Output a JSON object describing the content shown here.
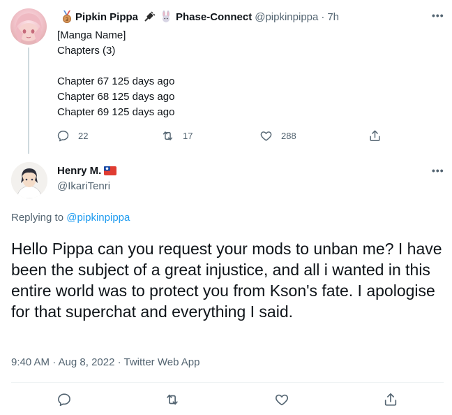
{
  "parent": {
    "display_name": "Pipkin Pippa",
    "org_name": "Phase-Connect",
    "handle": "@pipkinpippa",
    "separator": "·",
    "time": "7h",
    "text": "[Manga Name]\nChapters (3)\n\nChapter 67 125 days ago\nChapter 68 125 days ago\nChapter 69 125 days ago",
    "reply_count": "22",
    "retweet_count": "17",
    "like_count": "288",
    "icons": [
      "medal-icon",
      "bunny-icon",
      "more-icon",
      "reply-icon",
      "retweet-icon",
      "like-icon",
      "share-icon"
    ]
  },
  "reply": {
    "display_name": "Henry M.",
    "handle": "@IkariTenri",
    "replying_to_prefix": "Replying to",
    "replying_to_handle": "@pipkinpippa",
    "text": "Hello Pippa can you request your mods to unban me? I have been the subject of a great injustice, and all i wanted in this entire world was to protect you from Kson's fate. I apologise for that superchat and everything I said.",
    "timestamp": "9:40 AM · Aug 8, 2022 · Twitter Web App"
  },
  "colors": {
    "text": "#0f1419",
    "muted": "#536471",
    "link": "#1d9bf0",
    "thread_line": "#cfd9de",
    "divider": "#eff3f4"
  }
}
